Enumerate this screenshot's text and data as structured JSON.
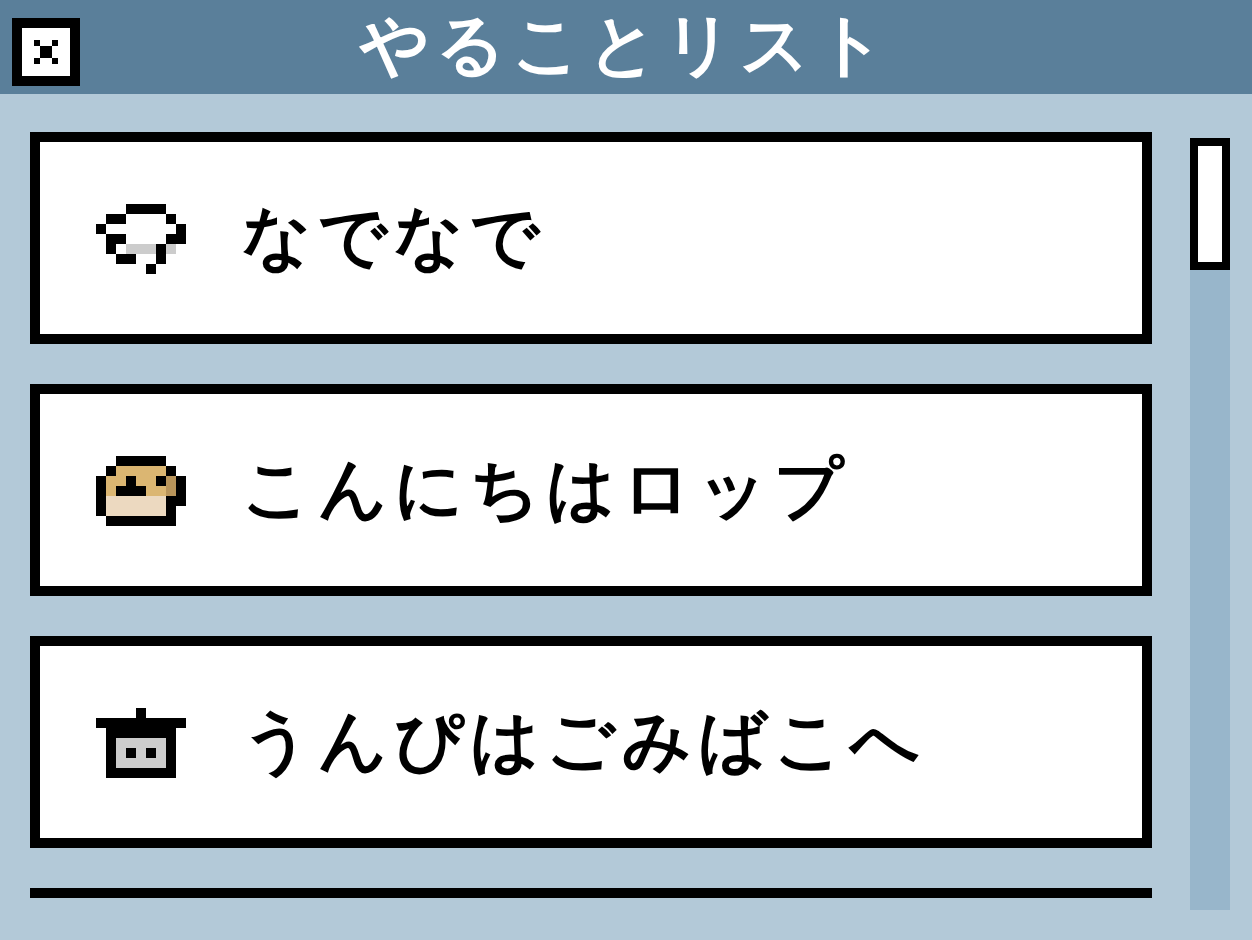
{
  "window": {
    "title": "やることリスト"
  },
  "items": [
    {
      "label": "なでなで",
      "kind": "bubble"
    },
    {
      "label": "こんにちはロップ",
      "kind": "dog"
    },
    {
      "label": "うんぴはごみばこへ",
      "kind": "trash"
    }
  ]
}
